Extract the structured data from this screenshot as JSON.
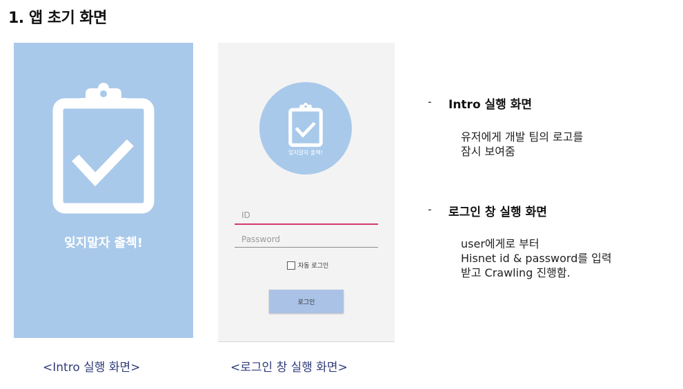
{
  "title": "1. 앱 초기 화면",
  "intro_screen": {
    "app_name": "잊지말자 출첵!"
  },
  "login_screen": {
    "app_name": "잊지말자 출첵!",
    "id_placeholder": "ID",
    "password_placeholder": "Password",
    "auto_login_label": "자동 로그인",
    "login_button": "로그인"
  },
  "captions": {
    "intro": "<Intro 실행 화면>",
    "login": "<로그인 창 실행 화면>"
  },
  "descriptions": [
    {
      "bullet": "-",
      "heading": "Intro 실행 화면",
      "lines": [
        "유저에게 개발 팀의 로고를",
        "잠시 보여줌"
      ]
    },
    {
      "bullet": "-",
      "heading": "로그인 창 실행 화면",
      "lines": [
        "user에게로 부터",
        "Hisnet id & password를 입력",
        "받고 Crawling 진행함."
      ]
    }
  ],
  "colors": {
    "screen_blue": "#a9c9ea",
    "id_underline": "#d23a6a",
    "caption_text": "#2f3b7a",
    "login_button_bg": "#aac2e6"
  },
  "icons": {
    "logo": "clipboard-check-icon"
  }
}
